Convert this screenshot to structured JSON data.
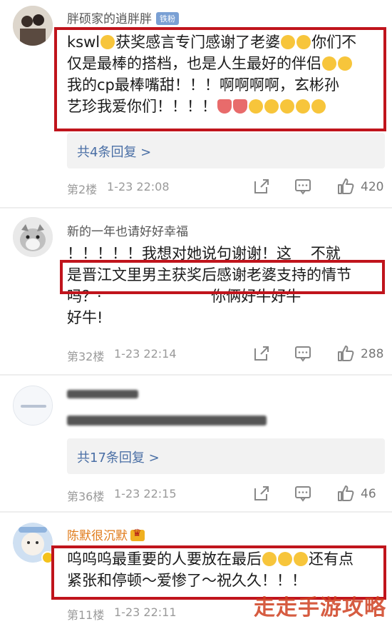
{
  "comments": [
    {
      "username": "胖硕家的逍胖胖",
      "badge": "铁粉",
      "text": "kswl😭获奖感言专门感谢了老婆😭😭你们不仅是最棒的搭档，也是人生最好的伴侣🥰🥰我的cp最棒嘴甜！！！啊啊啊啊，玄彬孙艺珍我爱你们！！！！💘💘😭😭😭😭😭",
      "replies": "共4条回复 >",
      "floor": "第2楼",
      "date": "1-23 22:08",
      "likes": "420"
    },
    {
      "username": "新的一年也请好好幸福",
      "text_line1": "！！！！！我想对她说句谢谢！这",
      "text_line1_tail": "不就",
      "text_line2": "是晋江文里男主获奖后感谢老婆支持的情节",
      "text_line3": "吗？·",
      "text_line3_tail": "你俩好牛好牛",
      "text_line4": "好牛!",
      "floor": "第32楼",
      "date": "1-23 22:14",
      "likes": "288"
    },
    {
      "username": "",
      "text_line1": "",
      "replies": "共17条回复 >",
      "floor": "第36楼",
      "date": "1-23 22:15",
      "likes": "46"
    },
    {
      "username": "陈默很沉默",
      "text": "呜呜呜最重要的人要放在最后😭😭😭还有点紧张和停顿～爱惨了～祝久久！！！",
      "floor": "第11楼",
      "date": "1-23 22:11"
    }
  ],
  "watermark": "走走手游攻略",
  "colors": {
    "highlight_box": "#c0141c",
    "reply_link": "#4a6fa5",
    "vip_name": "#e07b1a"
  },
  "icons": [
    "share-icon",
    "comment-icon",
    "like-icon"
  ]
}
